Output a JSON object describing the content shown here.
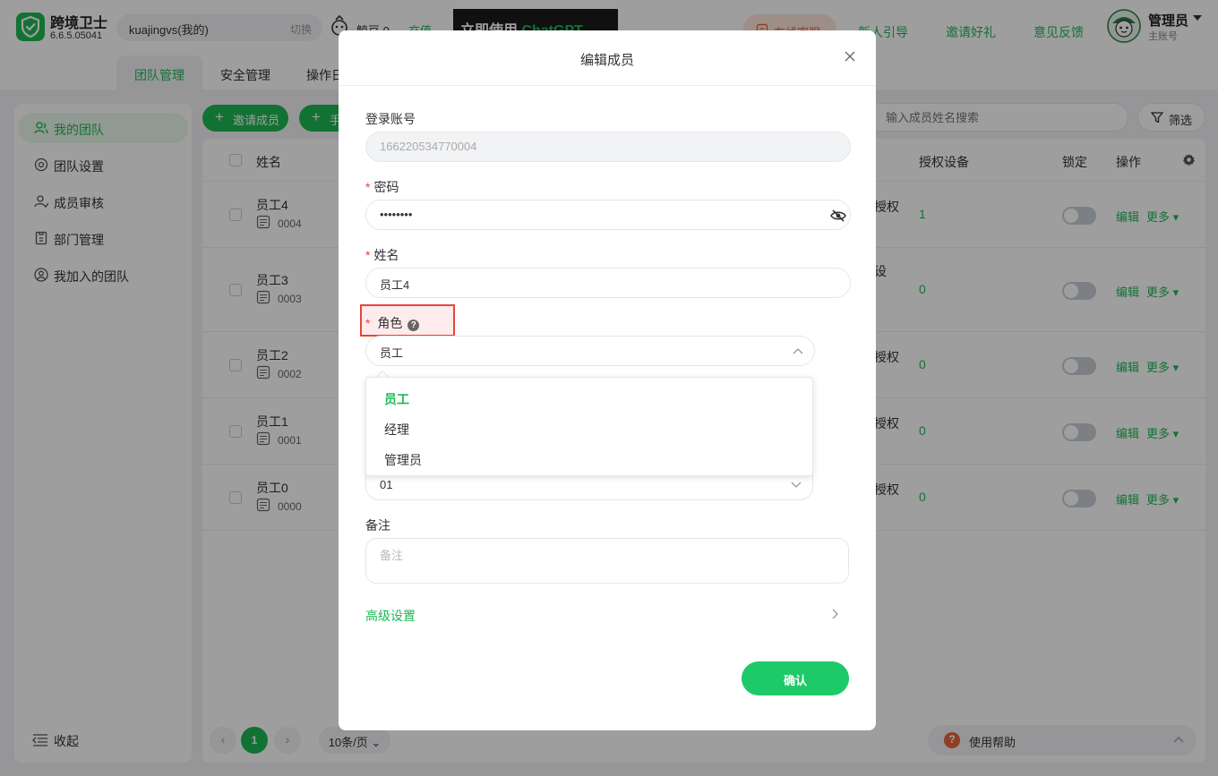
{
  "app": {
    "name": "跨境卫士",
    "version": "6.6.5.05041"
  },
  "account": {
    "name": "kuajingvs(我的)",
    "switch_label": "切换"
  },
  "coins": {
    "label": "鲸豆 0",
    "recharge_label": "充值"
  },
  "promo": {
    "text_a": "立即使用 ",
    "text_b": "ChatGPT"
  },
  "header_links": {
    "online_service": "在线客服",
    "guide": "新人引导",
    "invite": "邀请好礼",
    "feedback": "意见反馈"
  },
  "user": {
    "name": "管理员",
    "role": "主账号"
  },
  "tabs": [
    {
      "label": "团队管理"
    },
    {
      "label": "安全管理"
    },
    {
      "label": "操作日"
    }
  ],
  "sidebar": {
    "items": [
      {
        "label": "我的团队",
        "icon": "team-icon"
      },
      {
        "label": "团队设置",
        "icon": "settings-icon"
      },
      {
        "label": "成员审核",
        "icon": "member-review-icon"
      },
      {
        "label": "部门管理",
        "icon": "department-icon"
      },
      {
        "label": "我加入的团队",
        "icon": "joined-team-icon"
      }
    ],
    "collapse_label": "收起"
  },
  "toolbar": {
    "invite_label": "邀请成员",
    "second_label": "手",
    "search_placeholder": "输入成员姓名搜索",
    "filter_label": "筛选"
  },
  "table": {
    "columns": {
      "name": "姓名",
      "auth_devices": "授权设备",
      "lock": "锁定",
      "actions": "操作"
    },
    "rows": [
      {
        "name": "员工4",
        "id": "0004",
        "auth": "授权",
        "count": "1",
        "edit": "编辑",
        "more": "更多"
      },
      {
        "name": "员工3",
        "id": "0003",
        "auth": "设",
        "count": "0",
        "edit": "编辑",
        "more": "更多"
      },
      {
        "name": "员工2",
        "id": "0002",
        "auth": "授权",
        "count": "0",
        "edit": "编辑",
        "more": "更多"
      },
      {
        "name": "员工1",
        "id": "0001",
        "auth": "授权",
        "count": "0",
        "edit": "编辑",
        "more": "更多"
      },
      {
        "name": "员工0",
        "id": "0000",
        "auth": "授权",
        "count": "0",
        "edit": "编辑",
        "more": "更多"
      }
    ]
  },
  "pagination": {
    "current": "1",
    "page_size": "10条/页"
  },
  "help": {
    "label": "使用帮助"
  },
  "modal": {
    "title": "编辑成员",
    "login_label": "登录账号",
    "login_value": "166220534770004",
    "password_label": "密码",
    "password_value": "••••••••",
    "name_label": "姓名",
    "name_value": "员工4",
    "role_label": "角色",
    "role_value": "员工",
    "role_options": [
      "员工",
      "经理",
      "管理员"
    ],
    "department_value": "01",
    "remark_label": "备注",
    "remark_placeholder": "备注",
    "advanced_label": "高级设置",
    "confirm_label": "确认"
  },
  "colors": {
    "accent": "#1db954",
    "danger": "#e8443c",
    "service": "#e8643c"
  }
}
